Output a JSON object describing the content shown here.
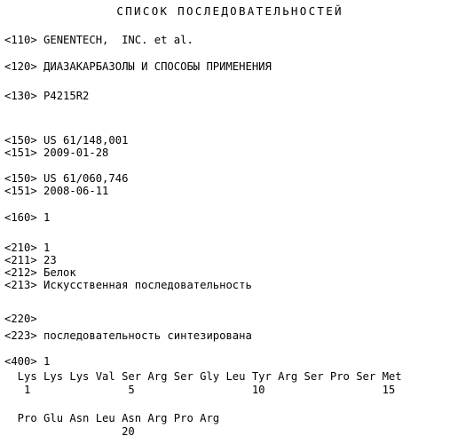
{
  "document": {
    "title": "СПИСОК ПОСЛЕДОВАТЕЛЬНОСТЕЙ",
    "language": "ru"
  },
  "fields": {
    "applicant": {
      "tag": "<110>",
      "value": "GENENTECH,  INC. et al.",
      "line": "<110> GENENTECH,  INC. et al."
    },
    "invention_title": {
      "tag": "<120>",
      "value": "ДИАЗАКАРБАЗОЛЫ И СПОСОБЫ ПРИМЕНЕНИЯ",
      "line": "<120> ДИАЗАКАРБАЗОЛЫ И СПОСОБЫ ПРИМЕНЕНИЯ"
    },
    "file_reference": {
      "tag": "<130>",
      "value": "P4215R2",
      "line": "<130> P4215R2"
    },
    "priority_1_number": {
      "tag": "<150>",
      "value": "US 61/148,001",
      "line": "<150> US 61/148,001"
    },
    "priority_1_date": {
      "tag": "<151>",
      "value": "2009-01-28",
      "line": "<151> 2009-01-28"
    },
    "priority_2_number": {
      "tag": "<150>",
      "value": "US 61/060,746",
      "line": "<150> US 61/060,746"
    },
    "priority_2_date": {
      "tag": "<151>",
      "value": "2008-06-11",
      "line": "<151> 2008-06-11"
    },
    "number_of_sequences": {
      "tag": "<160>",
      "value": "1",
      "line": "<160> 1"
    },
    "seq_id_no": {
      "tag": "<210>",
      "value": "1",
      "line": "<210> 1"
    },
    "length": {
      "tag": "<211>",
      "value": "23",
      "line": "<211> 23"
    },
    "type": {
      "tag": "<212>",
      "value": "Белок",
      "line": "<212> Белок"
    },
    "organism": {
      "tag": "<213>",
      "value": "Искусственная последовательность",
      "line": "<213> Искусственная последовательность"
    },
    "feature": {
      "tag": "<220>",
      "value": "",
      "line": "<220>"
    },
    "other_information": {
      "tag": "<223>",
      "value": "последовательность синтезирована",
      "line": "<223> последовательность синтезирована"
    },
    "sequence_header": {
      "tag": "<400>",
      "value": "1",
      "line": "<400> 1"
    }
  },
  "sequence": {
    "rows": [
      {
        "residues": "  Lys Lys Lys Val Ser Arg Ser Gly Leu Tyr Arg Ser Pro Ser Met",
        "numbers": "   1               5                  10                  15"
      },
      {
        "residues": "  Pro Glu Asn Leu Asn Arg Pro Arg",
        "numbers": "                  20"
      }
    ]
  }
}
